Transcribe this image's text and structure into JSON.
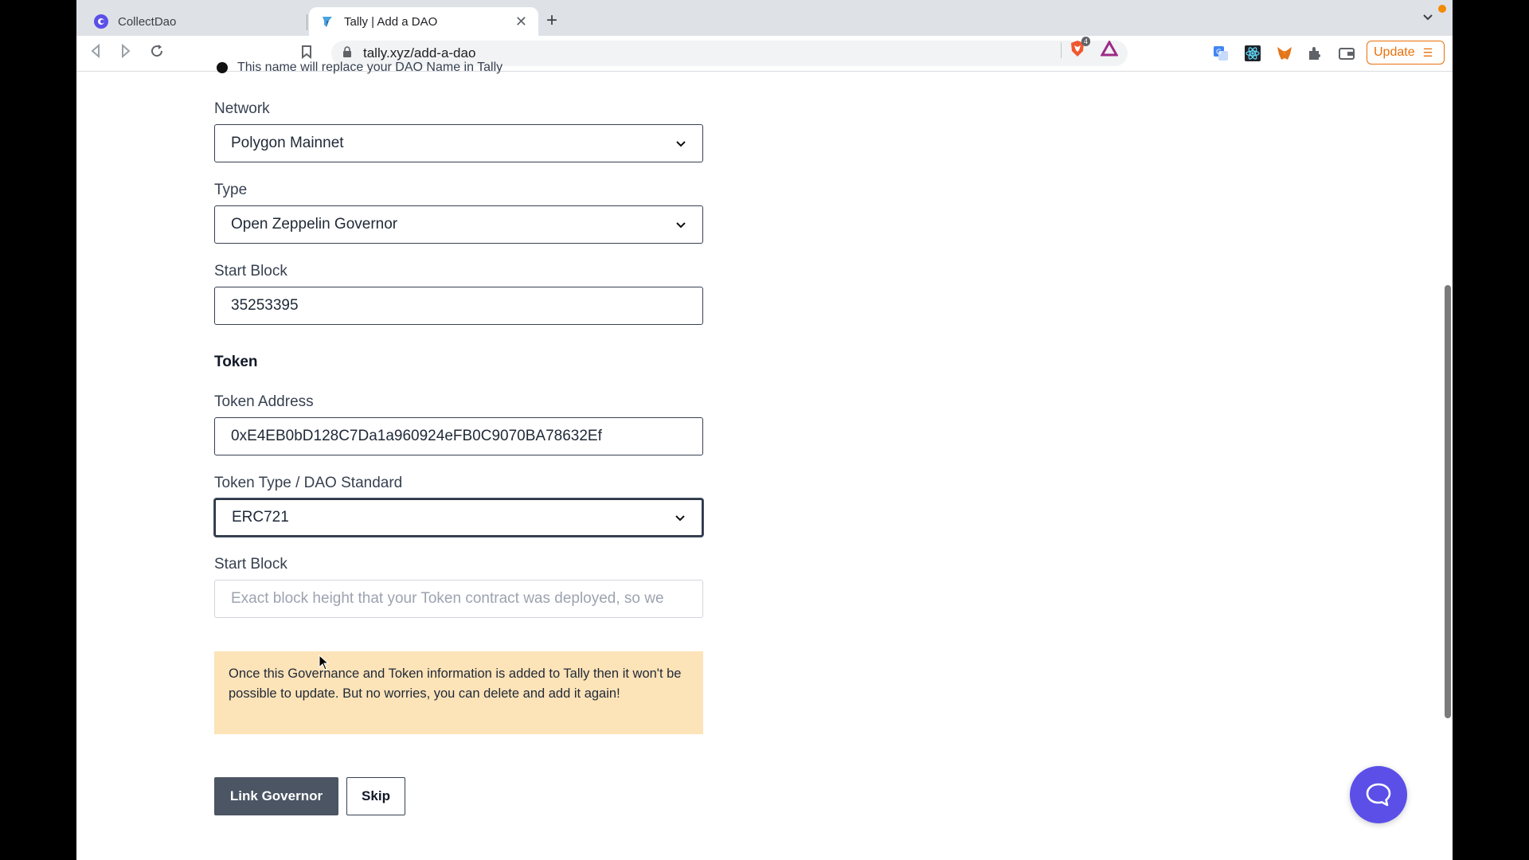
{
  "browser": {
    "tabs": [
      {
        "title": "CollectDao",
        "active": false
      },
      {
        "title": "Tally | Add a DAO",
        "active": true
      }
    ],
    "url": "tally.xyz/add-a-dao",
    "shield_count": "4",
    "update_label": "Update"
  },
  "form": {
    "hint_text": "This name will replace your DAO Name in Tally",
    "network": {
      "label": "Network",
      "value": "Polygon Mainnet"
    },
    "type": {
      "label": "Type",
      "value": "Open Zeppelin Governor"
    },
    "start_block": {
      "label": "Start Block",
      "value": "35253395"
    },
    "token_section": "Token",
    "token_address": {
      "label": "Token Address",
      "value": "0xE4EB0bD128C7Da1a960924eFB0C9070BA78632Ef"
    },
    "token_type": {
      "label": "Token Type / DAO Standard",
      "value": "ERC721"
    },
    "token_start_block": {
      "label": "Start Block",
      "placeholder": "Exact block height that your Token contract was deployed, so we"
    },
    "notice": "Once this Governance and Token information is added to Tally then it won't be possible to update. But no worries, you can delete and add it again!",
    "link_button": "Link Governor",
    "skip_button": "Skip"
  },
  "colors": {
    "primary_button": "#4b5563",
    "notice_bg": "#fde3b8",
    "chat_fab": "#5b4fe8",
    "update_accent": "#e8710a"
  }
}
